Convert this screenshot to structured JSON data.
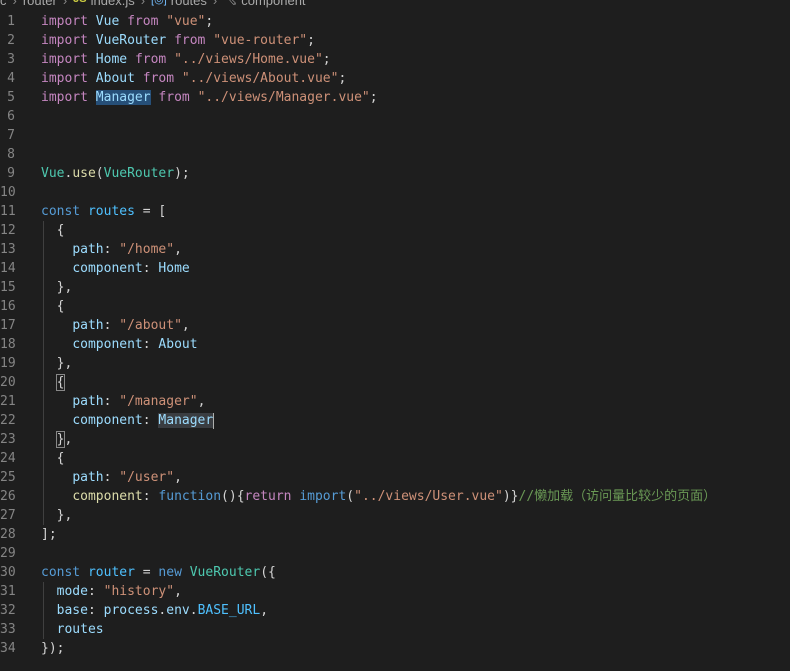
{
  "breadcrumb": {
    "items": [
      "c",
      "router",
      "index.js",
      "routes",
      "component"
    ]
  },
  "lines": [
    {
      "n": "1"
    },
    {
      "n": "2"
    },
    {
      "n": "3"
    },
    {
      "n": "4"
    },
    {
      "n": "5"
    },
    {
      "n": "6"
    },
    {
      "n": "7"
    },
    {
      "n": "8"
    },
    {
      "n": "9"
    },
    {
      "n": "10"
    },
    {
      "n": "11"
    },
    {
      "n": "12"
    },
    {
      "n": "13"
    },
    {
      "n": "14"
    },
    {
      "n": "15"
    },
    {
      "n": "16"
    },
    {
      "n": "17"
    },
    {
      "n": "18"
    },
    {
      "n": "19"
    },
    {
      "n": "20"
    },
    {
      "n": "21"
    },
    {
      "n": "22"
    },
    {
      "n": "23"
    },
    {
      "n": "24"
    },
    {
      "n": "25"
    },
    {
      "n": "26"
    },
    {
      "n": "27"
    },
    {
      "n": "28"
    },
    {
      "n": "29"
    },
    {
      "n": "30"
    },
    {
      "n": "31"
    },
    {
      "n": "32"
    },
    {
      "n": "33"
    },
    {
      "n": "34"
    }
  ],
  "tok": {
    "import": "import",
    "from": "from",
    "const": "const",
    "new": "new",
    "function": "function",
    "return": "return",
    "Vue": "Vue",
    "VueRouter": "VueRouter",
    "Home": "Home",
    "About": "About",
    "Manager": "Manager",
    "s_vue": "\"vue\"",
    "s_vue_router": "\"vue-router\"",
    "s_home_vue": "\"../views/Home.vue\"",
    "s_about_vue": "\"../views/About.vue\"",
    "s_manager_vue": "\"../views/Manager.vue\"",
    "s_user_vue": "\"../views/User.vue\"",
    "semi": ";",
    "use": "use",
    "dot": ".",
    "lparen": "(",
    "rparen_semi": ");",
    "routes": "routes",
    "eq_lbr": " = [",
    "eq": " = ",
    "lbrace": "{",
    "rbrace_comma": "},",
    "rbrace": "}",
    "path_key": "path",
    "component_key": "component",
    "colon_sp": ": ",
    "comma": ",",
    "s_home": "\"/home\"",
    "s_about": "\"/about\"",
    "s_manager": "\"/manager\"",
    "s_user": "\"/user\"",
    "fn_open": "(){",
    "import_open": "(",
    "import_close": ")}",
    "comment": "//懒加载（访问量比较少的页面）",
    "rbracket_semi": "];",
    "router": "router",
    "open_call": "({",
    "mode_key": "mode",
    "s_history": "\"history\"",
    "base_key": "base",
    "process": "process",
    "env": "env",
    "base_url": "BASE_URL",
    "close_call": "});"
  }
}
